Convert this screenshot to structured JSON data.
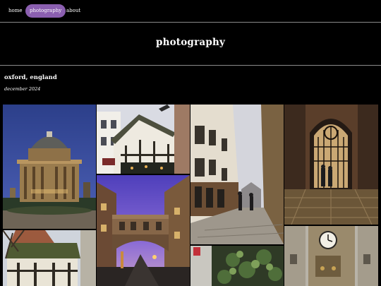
{
  "nav": {
    "items": [
      {
        "label": "home",
        "active": false
      },
      {
        "label": "photography",
        "active": true
      },
      {
        "label": "about",
        "active": false
      }
    ],
    "active_color": "#8b5fb0"
  },
  "page": {
    "title": "photography"
  },
  "album": {
    "title": "oxford, england",
    "date": "december 2024"
  },
  "gallery": {
    "photos": [
      {
        "icon": "radcliffe-camera-photo"
      },
      {
        "icon": "tudor-street-photo"
      },
      {
        "icon": "bridge-of-sighs-photo"
      },
      {
        "icon": "narrow-lane-photo"
      },
      {
        "icon": "college-gate-photo"
      },
      {
        "icon": "cottage-photo"
      },
      {
        "icon": "ivy-photo"
      },
      {
        "icon": "clock-tower-photo"
      }
    ]
  }
}
